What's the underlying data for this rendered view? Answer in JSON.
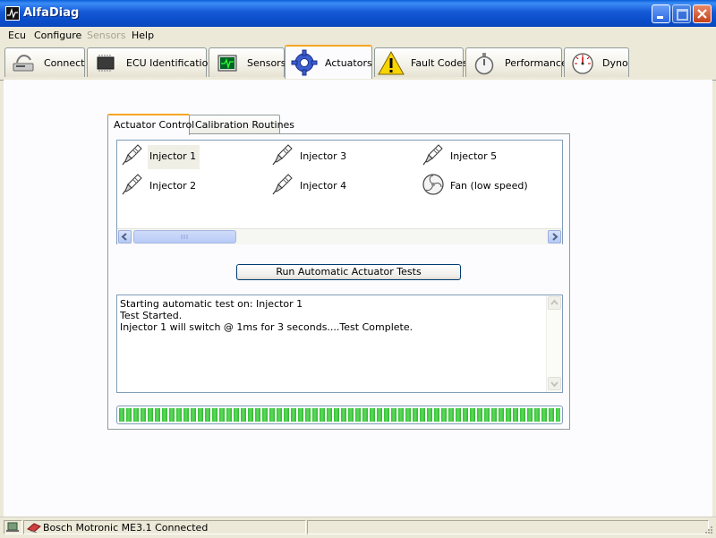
{
  "window": {
    "title": "AlfaDiag"
  },
  "menu": {
    "items": [
      "Ecu",
      "Configure",
      "Sensors",
      "Help"
    ]
  },
  "toolbar_tabs": [
    {
      "label": "Connect",
      "icon": "connect-icon"
    },
    {
      "label": "ECU Identification",
      "icon": "chip-icon"
    },
    {
      "label": "Sensors",
      "icon": "oscilloscope-icon"
    },
    {
      "label": "Actuators",
      "icon": "gear-icon"
    },
    {
      "label": "Fault Codes",
      "icon": "warning-icon"
    },
    {
      "label": "Performance",
      "icon": "stopwatch-icon"
    },
    {
      "label": "Dyno",
      "icon": "gauge-icon"
    }
  ],
  "active_toolbar_tab": "Actuators",
  "inner_tabs": [
    "Actuator Control",
    "Calibration Routines"
  ],
  "actuators": [
    {
      "label": "Injector 1",
      "icon": "injector-icon",
      "selected": true
    },
    {
      "label": "Injector 2",
      "icon": "injector-icon"
    },
    {
      "label": "Injector 3",
      "icon": "injector-icon"
    },
    {
      "label": "Injector 4",
      "icon": "injector-icon"
    },
    {
      "label": "Injector 5",
      "icon": "injector-icon"
    },
    {
      "label": "Fan (low speed)",
      "icon": "fan-icon"
    }
  ],
  "run_button": "Run Automatic Actuator Tests",
  "log": [
    "Starting automatic test on: Injector 1",
    "Test Started.",
    "Injector 1 will switch @ 1ms for 3 seconds....Test Complete."
  ],
  "progress": {
    "value": 1.0
  },
  "status": {
    "text": "Bosch Motronic ME3.1 Connected"
  },
  "colors": {
    "titlebar": "#0a4cc8",
    "active_tab_accent": "#f5a623",
    "progress": "#32c432"
  }
}
